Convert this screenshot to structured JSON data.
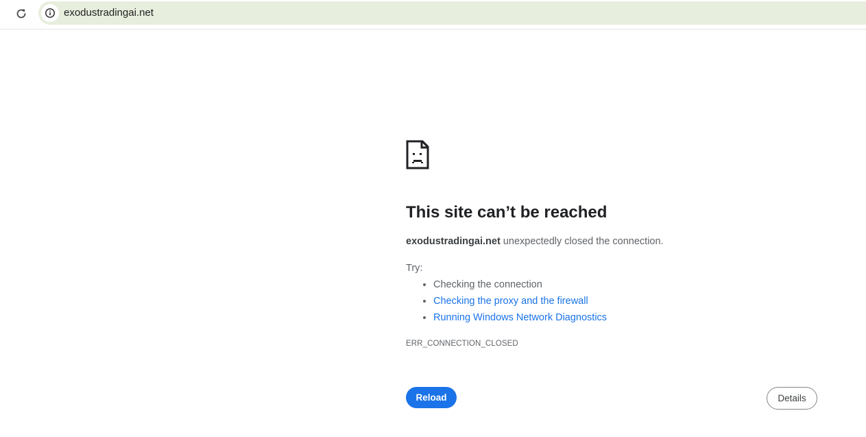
{
  "browser": {
    "url": "exodustradingai.net",
    "icons": {
      "reload": "reload-icon",
      "site_info": "info-icon"
    }
  },
  "error_page": {
    "icon": "sad-page-icon",
    "title": "This site can’t be reached",
    "host": "exodustradingai.net",
    "message": " unexpectedly closed the connection.",
    "try_label": "Try:",
    "suggestions": [
      "Checking the connection",
      "Checking the proxy and the firewall",
      "Running Windows Network Diagnostics"
    ],
    "error_code": "ERR_CONNECTION_CLOSED",
    "reload_label": "Reload",
    "details_label": "Details"
  },
  "colors": {
    "accent": "#1a73e8",
    "omnibox_background": "#e7eedd",
    "text_primary": "#202124",
    "text_secondary": "#5f6368"
  }
}
